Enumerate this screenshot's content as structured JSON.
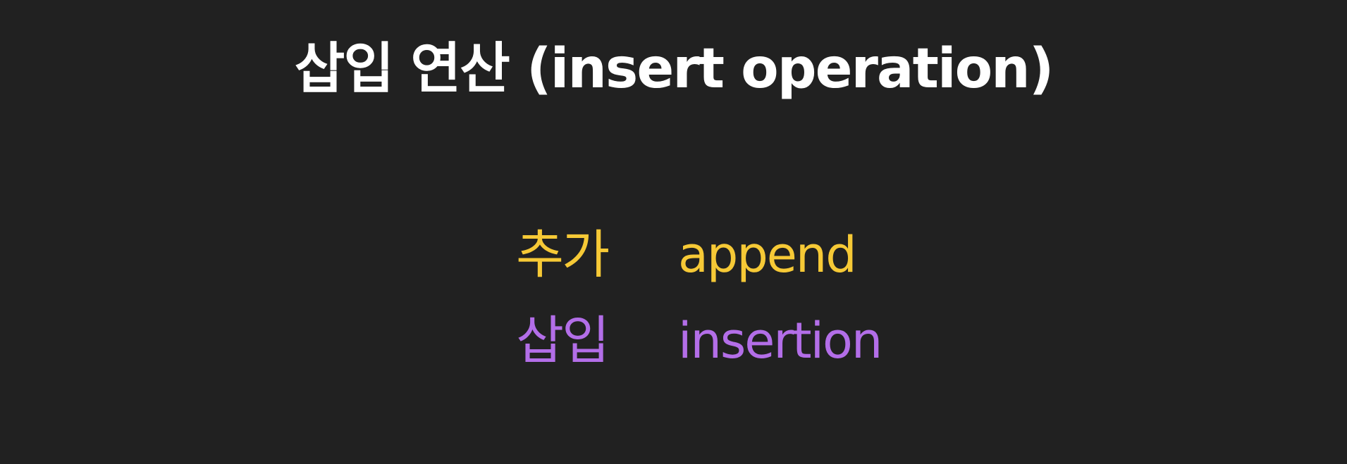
{
  "slide": {
    "title": "삽입 연산 (insert operation)",
    "terms": [
      {
        "korean": "추가",
        "english": "append",
        "color": "#f6c936"
      },
      {
        "korean": "삽입",
        "english": "insertion",
        "color": "#b36ee8"
      }
    ],
    "background_color": "#212121",
    "title_color": "#ffffff"
  }
}
